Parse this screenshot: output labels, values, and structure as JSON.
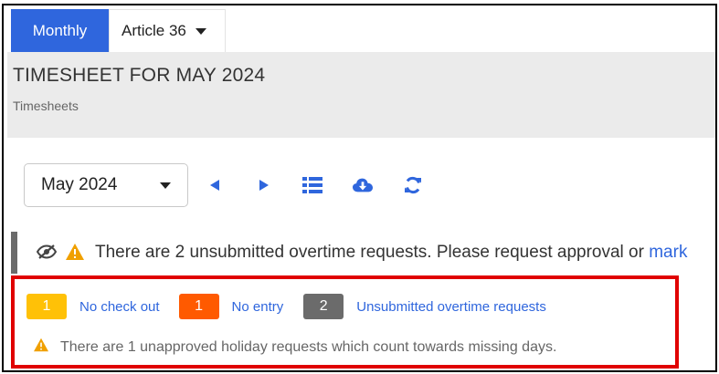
{
  "tabs": {
    "monthly_label": "Monthly",
    "article_label": "Article 36"
  },
  "header": {
    "title": "TIMESHEET FOR MAY 2024",
    "breadcrumb": "Timesheets"
  },
  "toolbar": {
    "month_value": "May 2024",
    "icons": [
      "prev-arrow-icon",
      "next-arrow-icon",
      "list-icon",
      "cloud-download-icon",
      "refresh-icon"
    ]
  },
  "alert": {
    "message": "There are 2 unsubmitted overtime requests. Please request approval or ",
    "link_text": "mark"
  },
  "legend": {
    "no_check_out": {
      "count": "1",
      "label": "No check out",
      "color": "#ffc107"
    },
    "no_entry": {
      "count": "1",
      "label": "No entry",
      "color": "#ff5a00"
    },
    "unsubmitted_overtime": {
      "count": "2",
      "label": "Unsubmitted overtime requests",
      "color": "#6b6b6b"
    }
  },
  "holiday_notice": "There are 1 unapproved holiday requests which count towards missing days.",
  "colors": {
    "accent": "#2f66dd",
    "warning": "#f0a000",
    "highlight_border": "#e00000"
  }
}
